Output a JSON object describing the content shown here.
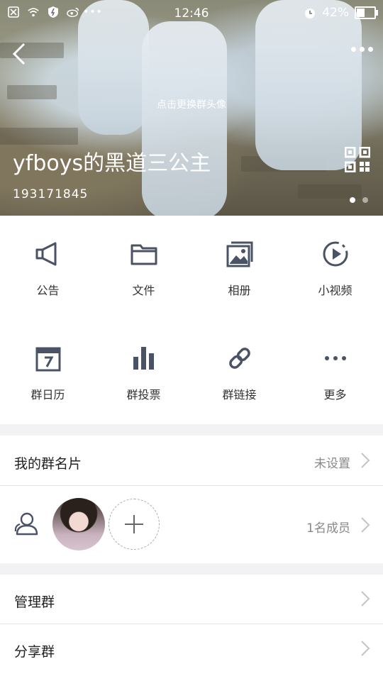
{
  "status_bar": {
    "time": "12:46",
    "battery": "42%",
    "battery_level": 0.42
  },
  "header": {
    "change_avatar_hint": "点击更换群头像",
    "group_name": "yfboys的黑道三公主",
    "group_id": "193171845",
    "page_dots": 2,
    "active_dot": 0
  },
  "features": [
    {
      "label": "公告",
      "icon": "megaphone-icon"
    },
    {
      "label": "文件",
      "icon": "folder-icon"
    },
    {
      "label": "相册",
      "icon": "album-icon"
    },
    {
      "label": "小视频",
      "icon": "video-icon"
    },
    {
      "label": "群日历",
      "icon": "calendar-icon"
    },
    {
      "label": "群投票",
      "icon": "bar-chart-icon"
    },
    {
      "label": "群链接",
      "icon": "link-icon"
    },
    {
      "label": "更多",
      "icon": "more-dots-icon"
    }
  ],
  "my_card": {
    "label": "我的群名片",
    "value": "未设置"
  },
  "members": {
    "count_text": "1名成员"
  },
  "manage": {
    "label": "管理群"
  },
  "share": {
    "label": "分享群"
  },
  "colors": {
    "icon": "#4a5366",
    "text": "#222222",
    "secondary": "#888888",
    "background": "#f2f2f4"
  }
}
